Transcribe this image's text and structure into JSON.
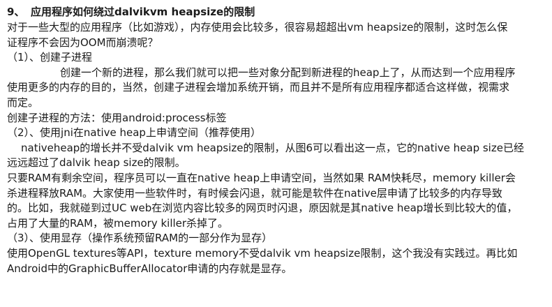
{
  "section": {
    "number": "9、",
    "title": "应用程序如何绕过dalvikvm heapsize的限制"
  },
  "lines": [
    "对于一些大型的应用程序（比如游戏），内存使用会比较多，很容易超超出vm heapsize的限制，这时怎么保",
    "证程序不会因为OOM而崩溃呢？",
    "（1）、创建子进程",
    "创建一个新的进程，那么我们就可以把一些对象分配到新进程的heap上了，从而达到一个应用程序",
    "使用更多的内存的目的，当然，创建子进程会增加系统开销，而且并不是所有应用程序都适合这样做，视需求",
    "而定。",
    "创建子进程的方法：使用android:process标签",
    "（2）、使用jni在native heap上申请空间（推荐使用）",
    "nativeheap的增长并不受dalvik vm heapsize的限制，从图6可以看出这一点，它的native heap size已经",
    "远远超过了dalvik heap size的限制。",
    "只要RAM有剩余空间，程序员可以一直在native heap上申请空间，当然如果 RAM快耗尽，memory killer会",
    "杀进程释放RAM。大家使用一些软件时，有时候会闪退，就可能是软件在native层申请了比较多的内存导致",
    "的。比如，我就碰到过UC web在浏览内容比较多的网页时闪退，原因就是其native heap增长到比较大的值，",
    "占用了大量的RAM，被memory killer杀掉了。",
    "（3）、使用显存（操作系统预留RAM的一部分作为显存）",
    "使用OpenGL textures等API，texture memory不受dalvik vm heapsize限制，这个我没有实践过。再比如",
    "Android中的GraphicBufferAllocator申请的内存就是显存。"
  ]
}
